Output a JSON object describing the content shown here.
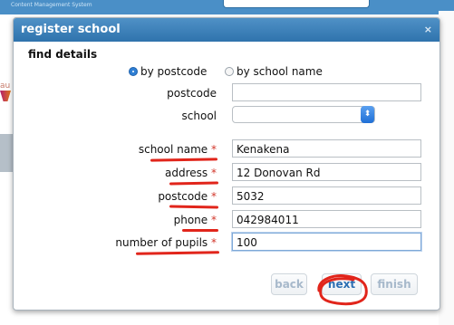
{
  "background": {
    "app_subtitle": "Content Management System"
  },
  "dialog": {
    "title": "register school",
    "close_glyph": "×",
    "section_title": "find details",
    "search_mode": {
      "option_postcode": "by postcode",
      "option_school_name": "by school name",
      "selected": "by postcode"
    },
    "search_fields": {
      "postcode_label": "postcode",
      "postcode_value": "",
      "school_label": "school",
      "school_value": ""
    },
    "fields": {
      "school_name_label": "school name",
      "school_name_value": "Kenakena",
      "address_label": "address",
      "address_value": "12 Donovan Rd",
      "postcode_label": "postcode",
      "postcode_value": "5032",
      "phone_label": "phone",
      "phone_value": "042984011",
      "pupils_label": "number of pupils",
      "pupils_value": "100",
      "required_marker": "*"
    },
    "buttons": {
      "back": "back",
      "next": "next",
      "finish": "finish"
    }
  },
  "colors": {
    "title_bar": "#3a80ba",
    "annotation": "#e1251b",
    "required": "#d2372b"
  }
}
